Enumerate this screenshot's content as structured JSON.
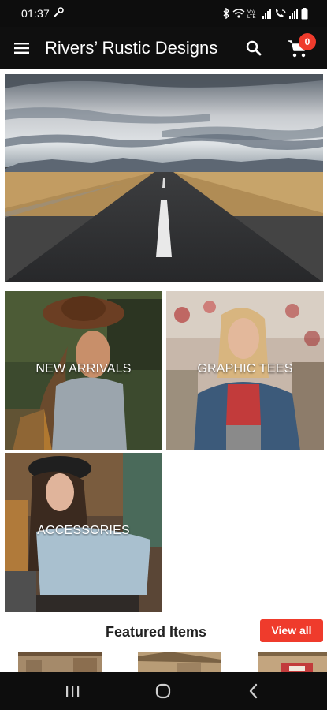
{
  "status_bar": {
    "time": "01:37",
    "icons": [
      "wrench-icon",
      "bluetooth-icon",
      "wifi-icon",
      "volte-icon",
      "signal-icon",
      "wifi-call-icon",
      "signal-icon",
      "battery-icon"
    ]
  },
  "app_bar": {
    "title": "Rivers’ Rustic Designs",
    "menu_icon": "hamburger-menu-icon",
    "search_icon": "search-icon",
    "cart_icon": "shopping-cart-icon",
    "cart_count": "0"
  },
  "categories": [
    {
      "label": "NEW ARRIVALS"
    },
    {
      "label": "GRAPHIC TEES"
    },
    {
      "label": "ACCESSORIES"
    }
  ],
  "featured": {
    "title": "Featured Items",
    "view_all_label": "View all"
  },
  "colors": {
    "accent": "#ef3b2c",
    "bar_background": "#0f0f0f"
  },
  "nav_bar": {
    "icons": [
      "recent-apps-icon",
      "home-icon",
      "back-icon"
    ]
  }
}
